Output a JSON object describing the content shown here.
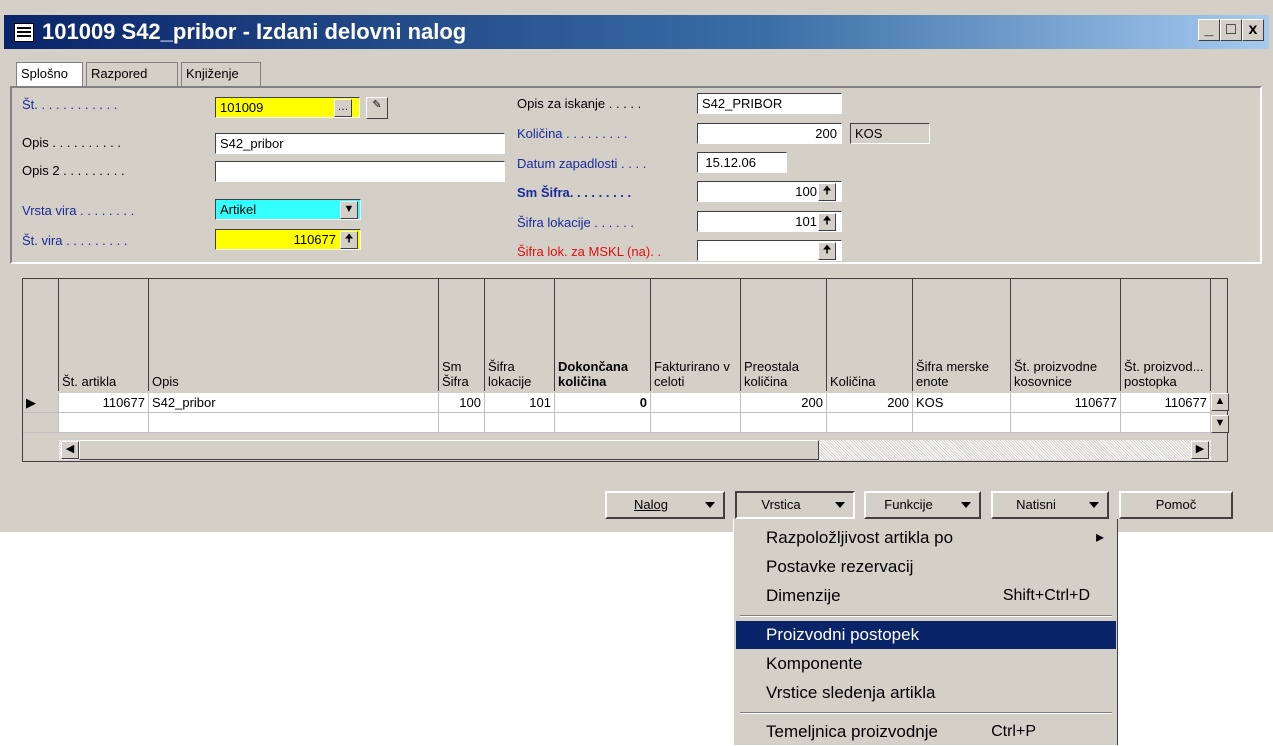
{
  "window": {
    "title": "101009 S42_pribor - Izdani delovni nalog",
    "controls": {
      "minimize": "_",
      "restore": "□",
      "close": "x"
    }
  },
  "tabs": [
    {
      "label": "Splošno",
      "active": true
    },
    {
      "label": "Razpored",
      "active": false
    },
    {
      "label": "Knjiženje",
      "active": false
    }
  ],
  "general_left": {
    "st_label": "Št. . . . . . . . . . . .",
    "st_value": "101009",
    "opis_label": "Opis . . . . . . . . . .",
    "opis_value": "S42_pribor",
    "opis2_label": "Opis 2 . . . . . . . . .",
    "opis2_value": "",
    "vrsta_vira_label": "Vrsta vira . . . . . . . .",
    "vrsta_vira_value": "Artikel",
    "st_vira_label": "Št. vira . . . . . . . . .",
    "st_vira_value": "110677"
  },
  "general_right": {
    "opis_iskanje_label": "Opis za iskanje . . . . .",
    "opis_iskanje_value": "S42_PRIBOR",
    "kolicina_label": "Količina . . . . . . . . .",
    "kolicina_value": "200",
    "kolicina_unit": "KOS",
    "datum_label": "Datum zapadlosti . . . .",
    "datum_value": "15.12.06",
    "sm_sifra_label": "Sm Šifra. . . . . . . . .",
    "sm_sifra_value": "100",
    "sifra_lok_label": "Šifra lokacije . . . . . .",
    "sifra_lok_value": "101",
    "sifra_mskl_label": "Šifra lok. za MSKL (na). .",
    "sifra_mskl_value": ""
  },
  "grid": {
    "headers": [
      "Št. artikla",
      "Opis",
      "Sm Šifra",
      "Šifra lokacije",
      "Dokončana količina",
      "Fakturirano v celoti",
      "Preostala količina",
      "Količina",
      "Šifra merske enote",
      "Št. proizvodne kosovnice",
      "Št. proizvod... postopka"
    ],
    "rows": [
      [
        "110677",
        "S42_pribor",
        "100",
        "101",
        "0",
        "",
        "200",
        "200",
        "KOS",
        "110677",
        "110677"
      ]
    ]
  },
  "buttons": {
    "nalog": "Nalog",
    "vrstica": "Vrstica",
    "funkcije": "Funkcije",
    "natisni": "Natisni",
    "pomoc": "Pomoč"
  },
  "menu": {
    "items": [
      {
        "label": "Razpoložljivost artikla po",
        "shortcut": "",
        "submenu": true
      },
      {
        "label": "Postavke rezervacij",
        "shortcut": ""
      },
      {
        "label": "Dimenzije",
        "shortcut": "Shift+Ctrl+D"
      },
      {
        "label": "Proizvodni postopek",
        "shortcut": "",
        "selected": true
      },
      {
        "label": "Komponente",
        "shortcut": ""
      },
      {
        "label": "Vrstice sledenja artikla",
        "shortcut": ""
      },
      {
        "label": "Temeljnica proizvodnje",
        "shortcut": "Ctrl+P"
      }
    ]
  },
  "colors": {
    "titlebar": "#0a246a",
    "highlight_yellow": "#ffff00",
    "highlight_cyan": "#33ffff",
    "menu_selected": "#0a246a",
    "red_label": "#e01010",
    "blue_label": "#1a2a9a"
  }
}
